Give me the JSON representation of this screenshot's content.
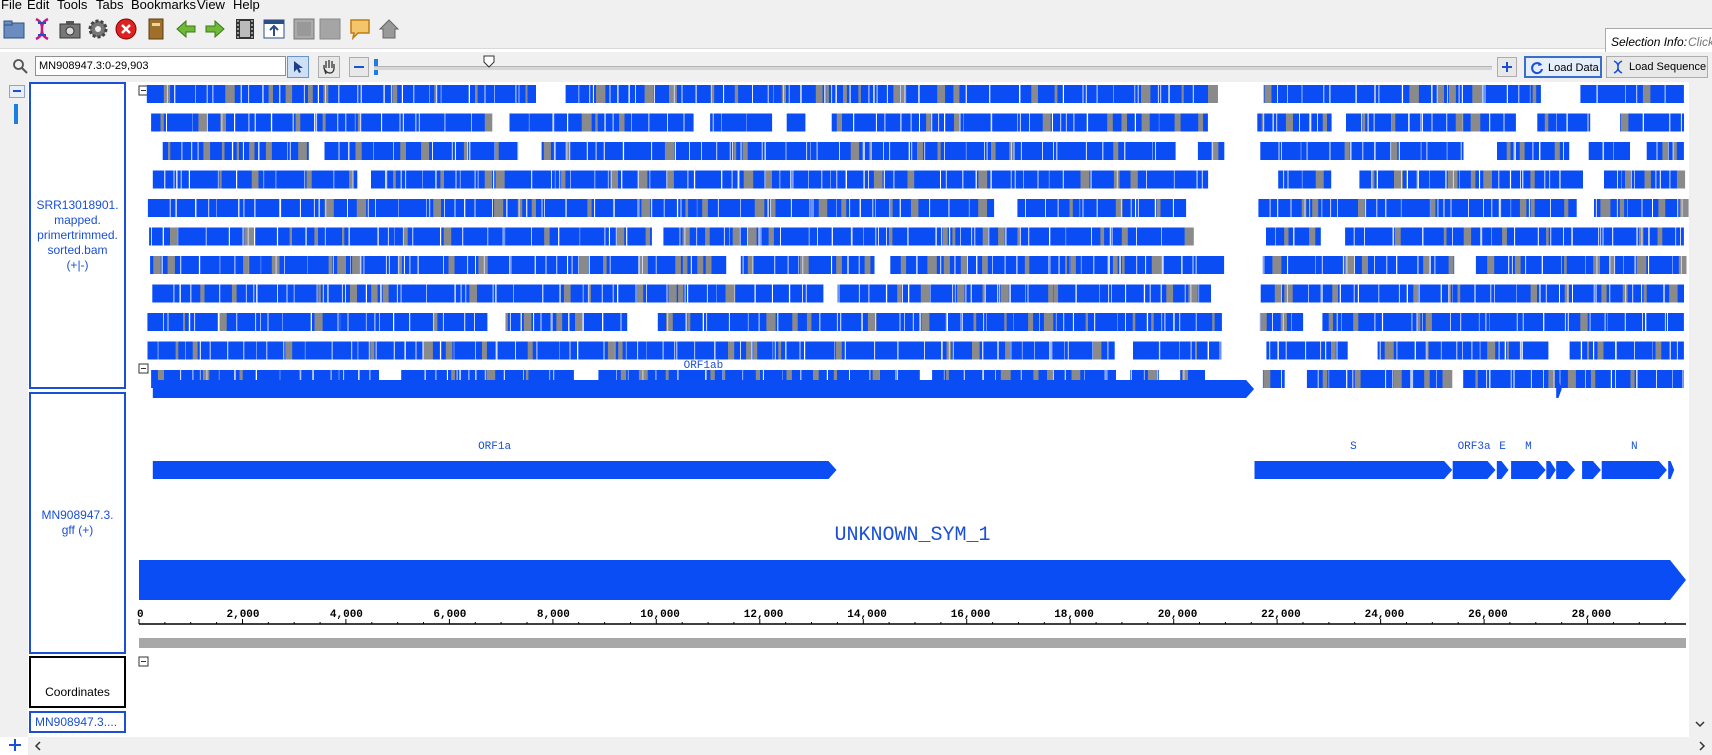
{
  "menu": [
    "File",
    "Edit",
    "Tools",
    "Tabs",
    "Bookmarks",
    "View",
    "Help"
  ],
  "toolbar": {
    "icons": [
      "open-folder-icon",
      "dna-icon",
      "camera-icon",
      "gear-icon",
      "stop-icon",
      "notebook-icon",
      "back-arrow-icon",
      "forward-arrow-icon",
      "film-icon",
      "export-icon",
      "blank-window-icon",
      "blank-panel-icon",
      "speech-bubble-icon",
      "home-icon"
    ],
    "selection_info_label": "Selection Info:",
    "selection_info_value": "Click"
  },
  "nav": {
    "location": "MN908947.3:0-29,903",
    "load_data": "Load Data",
    "load_sequence": "Load Sequence"
  },
  "tracks": {
    "bam_label": "SRR13018901.\nmapped.\nprimertrimmed.\nsorted.bam\n(+|-)",
    "gff_label": "MN908947.3.\ngff (+)",
    "coordinates_label": "Coordinates",
    "sequence_label": "MN908947.3...."
  },
  "colors": {
    "read": "#0a4df5",
    "mismatch": "#8a8a8a",
    "feature": "#0a4df5",
    "label_border": "#1a4fd6"
  },
  "genome_length": 29903,
  "features": [
    {
      "name": "ORF1ab",
      "start": 266,
      "end": 21555,
      "row": 0
    },
    {
      "name": "",
      "start": 27394,
      "end": 27500,
      "row": 0
    },
    {
      "name": "ORF1a",
      "start": 266,
      "end": 13483,
      "row": 1
    },
    {
      "name": "S",
      "start": 21563,
      "end": 25384,
      "row": 1
    },
    {
      "name": "ORF3a",
      "start": 25393,
      "end": 26220,
      "row": 1
    },
    {
      "name": "E",
      "start": 26245,
      "end": 26472,
      "row": 1
    },
    {
      "name": "M",
      "start": 26523,
      "end": 27191,
      "row": 1
    },
    {
      "name": "",
      "start": 27202,
      "end": 27387,
      "row": 1
    },
    {
      "name": "",
      "start": 27394,
      "end": 27759,
      "row": 1
    },
    {
      "name": "",
      "start": 27894,
      "end": 28259,
      "row": 1
    },
    {
      "name": "N",
      "start": 28274,
      "end": 29533,
      "row": 1
    },
    {
      "name": "",
      "start": 29558,
      "end": 29674,
      "row": 1
    },
    {
      "name": "UNKNOWN_SYM_1",
      "start": 0,
      "end": 29903,
      "row": 2
    }
  ],
  "axis_ticks": [
    "0",
    "2,000",
    "4,000",
    "6,000",
    "8,000",
    "10,000",
    "12,000",
    "14,000",
    "16,000",
    "18,000",
    "20,000",
    "22,000",
    "24,000",
    "26,000",
    "28,000"
  ],
  "coverage_gap": {
    "start": 21000,
    "end": 21600
  }
}
